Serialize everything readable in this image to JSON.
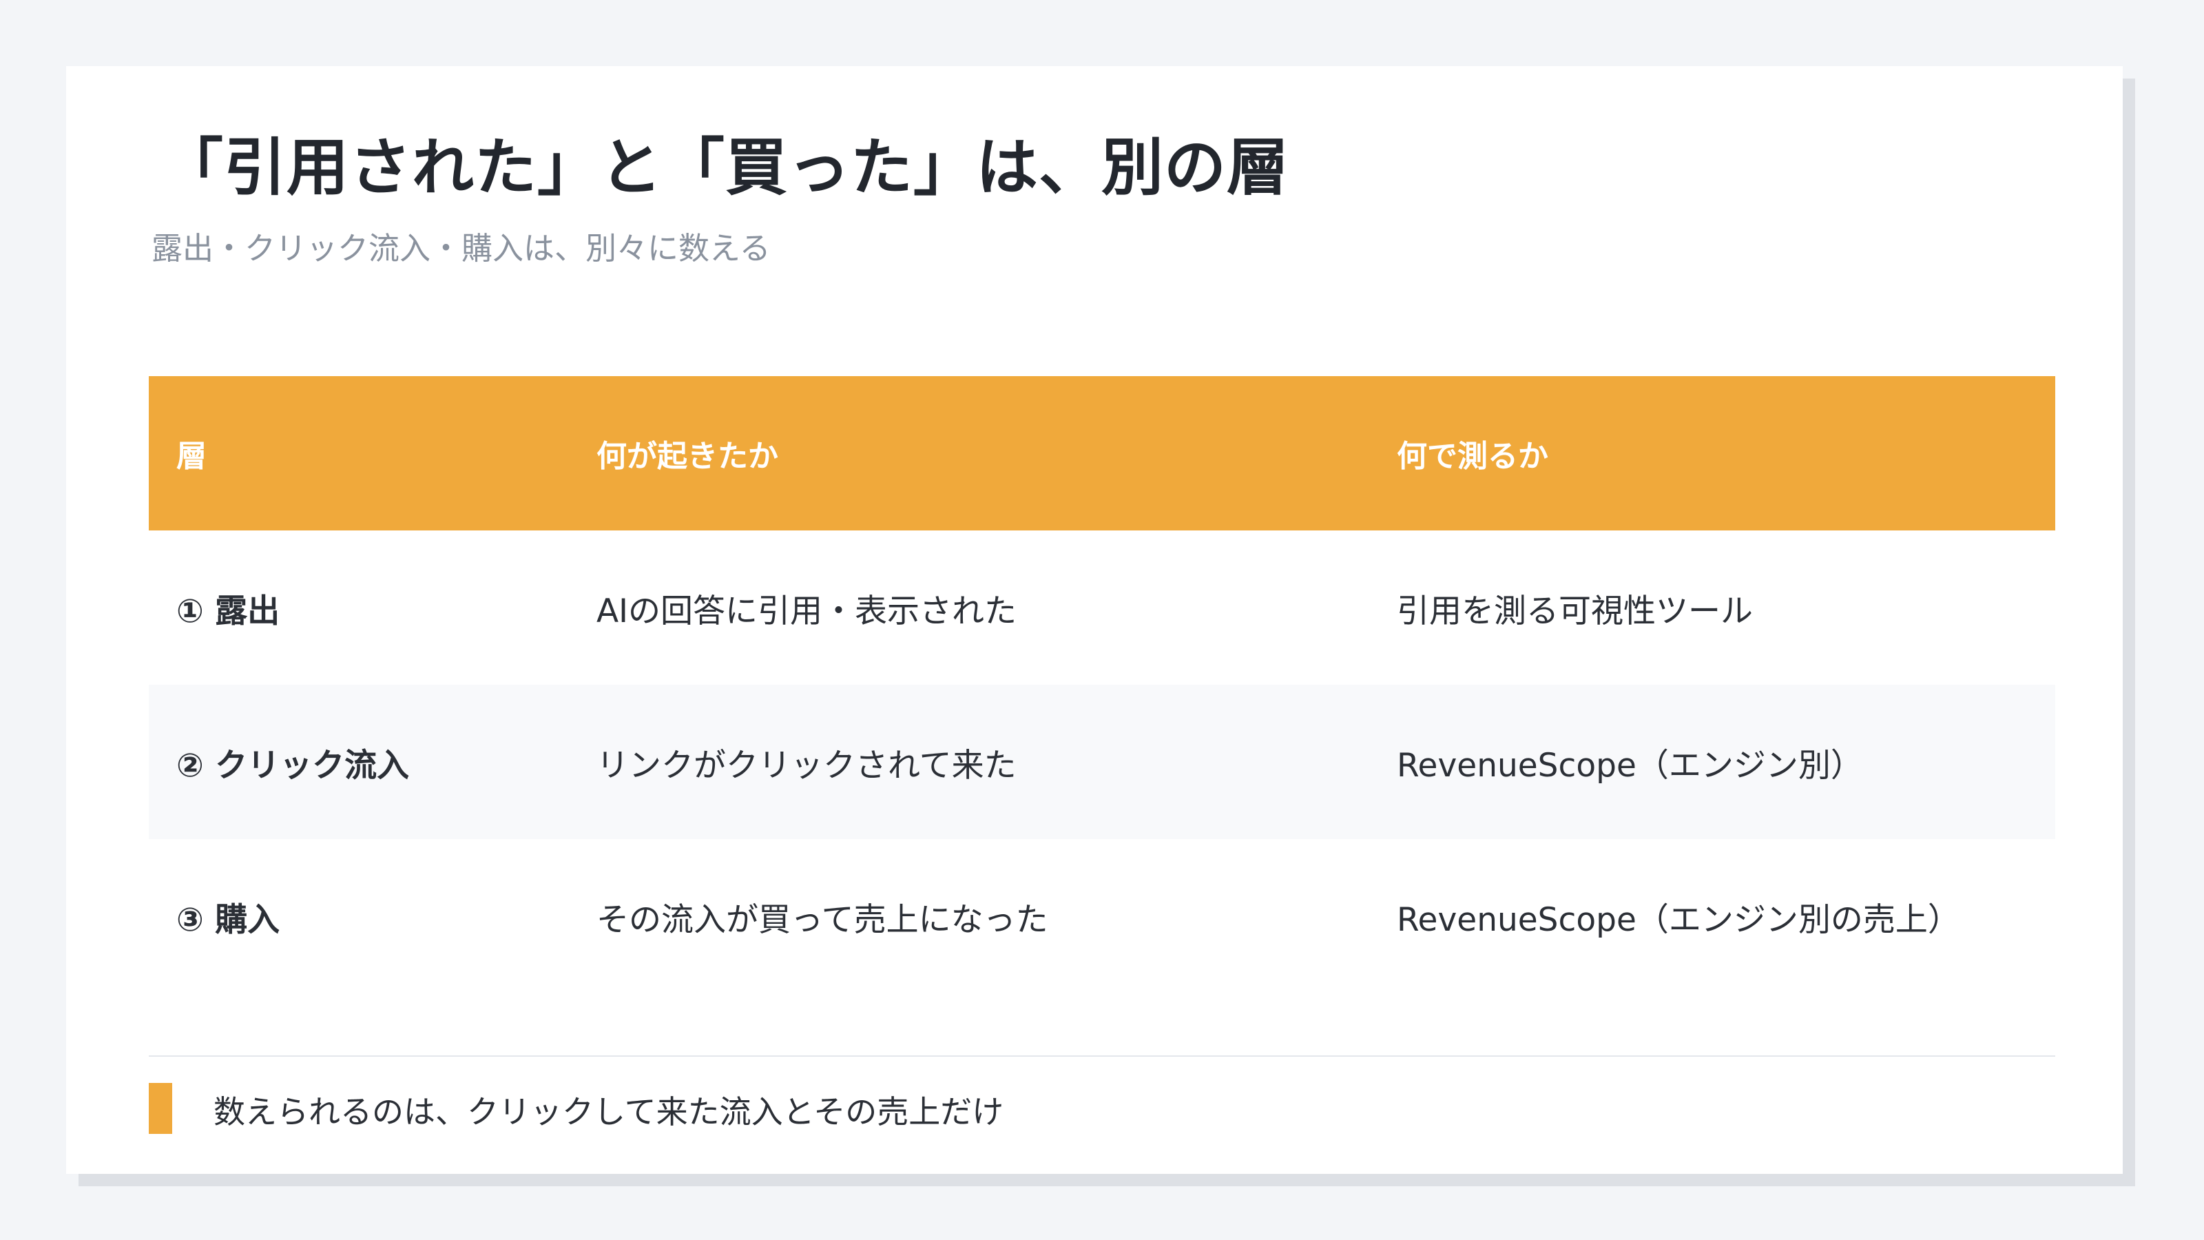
{
  "slide": {
    "title": "「引用された」と「買った」は、別の層",
    "subtitle": "露出・クリック流入・購入は、別々に数える",
    "accent_color": "#f0a93b"
  },
  "table": {
    "headers": [
      "層",
      "何が起きたか",
      "何で測るか"
    ],
    "rows": [
      [
        "① 露出",
        "AIの回答に引用・表示された",
        "引用を測る可視性ツール"
      ],
      [
        "② クリック流入",
        "リンクがクリックされて来た",
        "RevenueScope（エンジン別）"
      ],
      [
        "③ 購入",
        "その流入が買って売上になった",
        "RevenueScope（エンジン別の売上）"
      ]
    ]
  },
  "note": {
    "text": "数えられるのは、クリックして来た流入とその売上だけ"
  }
}
